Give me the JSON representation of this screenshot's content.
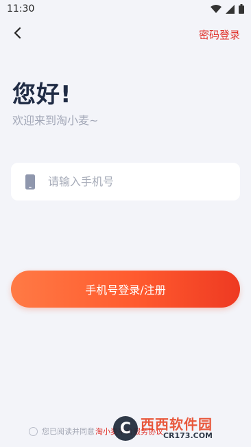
{
  "status_bar": {
    "time": "11:30",
    "icons": [
      "wifi-icon",
      "signal-icon",
      "battery-icon"
    ]
  },
  "nav": {
    "back_icon": "chevron-left-icon",
    "password_login": "密码登录"
  },
  "greeting": {
    "title": "您好!",
    "subtitle": "欢迎来到淘小麦~"
  },
  "phone_field": {
    "icon": "phone-icon",
    "placeholder": "请输入手机号",
    "value": ""
  },
  "login_button": {
    "label": "手机号登录/注册"
  },
  "agreement": {
    "prefix": "您已阅读并同意",
    "link": "淘小麦平台服务协议"
  },
  "watermark": {
    "logo": "C",
    "cn": "西西软件园",
    "en": "CR173.COM"
  },
  "colors": {
    "accent": "#e0302a",
    "button_start": "#ff7a45",
    "button_end": "#ee3a22",
    "background": "#f3f4f9",
    "title": "#1f2b44"
  }
}
